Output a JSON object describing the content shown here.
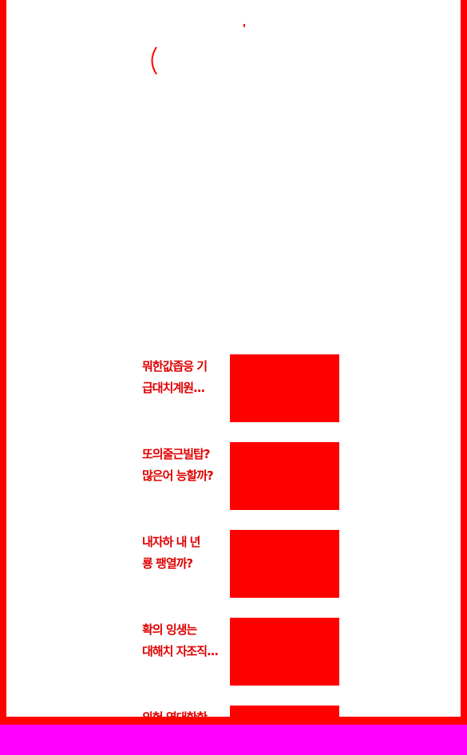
{
  "colors": {
    "frame": "#ff0000",
    "bottom_bar": "#ff00ff",
    "thumbnail": "#ff0000",
    "title_text": "#e00000",
    "background": "#ffffff"
  },
  "header": {
    "back_icon": "chevron-left-icon"
  },
  "articles": [
    {
      "title": "뭐한값좁응 기\n급대치계원...",
      "thumbnail_icon": "image-placeholder"
    },
    {
      "title": "또의줄근빌탑?\n많은어 능할까?",
      "thumbnail_icon": "image-placeholder"
    },
    {
      "title": "내자하 내 년\n룡 팽열까?",
      "thumbnail_icon": "image-placeholder"
    },
    {
      "title": "확의 잉생는\n대해치 자조직...",
      "thumbnail_icon": "image-placeholder"
    },
    {
      "title": "의헌 영대한한",
      "thumbnail_icon": "image-placeholder"
    }
  ]
}
